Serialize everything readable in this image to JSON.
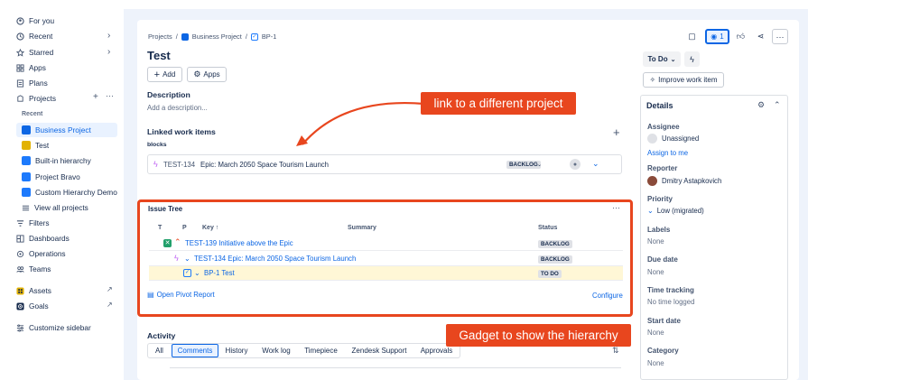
{
  "sidebar": {
    "items": [
      {
        "label": "For you",
        "icon": "for-you-icon"
      },
      {
        "label": "Recent",
        "icon": "clock-icon"
      },
      {
        "label": "Starred",
        "icon": "star-icon"
      },
      {
        "label": "Apps",
        "icon": "apps-icon"
      },
      {
        "label": "Plans",
        "icon": "plans-icon"
      },
      {
        "label": "Projects",
        "icon": "projects-icon"
      }
    ],
    "recent_label": "Recent",
    "projects": [
      {
        "label": "Business Project",
        "color": "#0c66e4"
      },
      {
        "label": "Test",
        "color": "#e2b203"
      },
      {
        "label": "Built-in hierarchy",
        "color": "#1d7afc"
      },
      {
        "label": "Project Bravo",
        "color": "#1d7afc"
      },
      {
        "label": "Custom Hierarchy Demo",
        "color": "#1d7afc"
      }
    ],
    "view_all": "View all projects",
    "lower": [
      {
        "label": "Filters"
      },
      {
        "label": "Dashboards"
      },
      {
        "label": "Operations"
      },
      {
        "label": "Teams"
      }
    ],
    "apps": [
      {
        "label": "Assets"
      },
      {
        "label": "Goals"
      }
    ],
    "customize": "Customize sidebar"
  },
  "breadcrumb": {
    "root": "Projects",
    "project": "Business Project",
    "issue": "BP-1",
    "sep": "/"
  },
  "issue": {
    "title": "Test",
    "add_label": "Add",
    "apps_label": "Apps",
    "description_heading": "Description",
    "description_placeholder": "Add a description...",
    "linked_heading": "Linked work items",
    "link_type": "blocks",
    "linked_item": {
      "key": "TEST-134",
      "summary": "Epic: March 2050 Space Tourism Launch",
      "status": "BACKLOG"
    }
  },
  "tree": {
    "title": "Issue Tree",
    "columns": {
      "t": "T",
      "p": "P",
      "key": "Key",
      "summary": "Summary",
      "status": "Status"
    },
    "rows": [
      {
        "text": "TEST-139 Initiative above the Epic",
        "status": "BACKLOG"
      },
      {
        "text": "TEST-134  Epic: March 2050 Space Tourism Launch",
        "status": "BACKLOG"
      },
      {
        "text": "BP-1 Test",
        "status": "TO DO"
      }
    ],
    "pivot_link": "Open Pivot Report",
    "configure_link": "Configure"
  },
  "activity": {
    "heading": "Activity",
    "tabs": [
      "All",
      "Comments",
      "History",
      "Work log",
      "Timepiece",
      "Zendesk Support",
      "Approvals"
    ],
    "active_tab": "Comments"
  },
  "header_actions": {
    "watch_count": "1"
  },
  "status_button": "To Do",
  "improve_button": "Improve work item",
  "details": {
    "heading": "Details",
    "assignee_label": "Assignee",
    "assignee_value": "Unassigned",
    "assign_to_me": "Assign to me",
    "reporter_label": "Reporter",
    "reporter_value": "Dmitry Astapkovich",
    "priority_label": "Priority",
    "priority_value": "Low (migrated)",
    "labels_label": "Labels",
    "labels_value": "None",
    "due_label": "Due date",
    "due_value": "None",
    "time_label": "Time tracking",
    "time_value": "No time logged",
    "start_label": "Start date",
    "start_value": "None",
    "category_label": "Category",
    "category_value": "None"
  },
  "annotations": {
    "link_callout": "link to a different project",
    "gadget_callout": "Gadget to show the hierarchy",
    "color": "#e8461e"
  }
}
